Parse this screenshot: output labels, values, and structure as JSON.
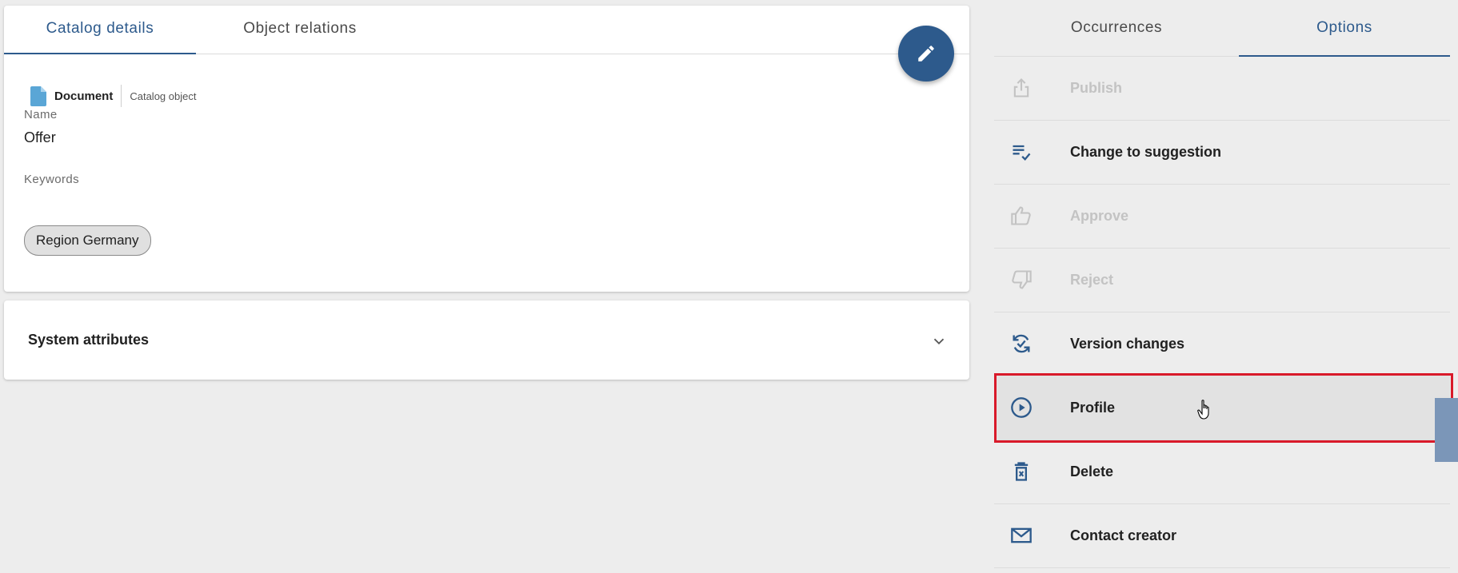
{
  "left_tabs": [
    {
      "label": "Catalog details",
      "active": true
    },
    {
      "label": "Object relations",
      "active": false
    }
  ],
  "edit_button": {
    "icon": "pencil-icon"
  },
  "object_type": {
    "type_label": "Document",
    "kind_label": "Catalog object",
    "icon": "document-icon"
  },
  "fields": {
    "name_label": "Name",
    "name_value": "Offer",
    "keywords_label": "Keywords",
    "keywords": [
      "Region Germany"
    ]
  },
  "system_attributes": {
    "title": "System attributes",
    "icon": "chevron-down-icon"
  },
  "right_tabs": [
    {
      "label": "Occurrences",
      "active": false
    },
    {
      "label": "Options",
      "active": true
    }
  ],
  "options": [
    {
      "label": "Publish",
      "icon": "share-icon",
      "disabled": true
    },
    {
      "label": "Change to suggestion",
      "icon": "playlist-check-icon",
      "disabled": false
    },
    {
      "label": "Approve",
      "icon": "thumb-up-icon",
      "disabled": true
    },
    {
      "label": "Reject",
      "icon": "thumb-down-icon",
      "disabled": true
    },
    {
      "label": "Version changes",
      "icon": "sync-check-icon",
      "disabled": false
    },
    {
      "label": "Profile",
      "icon": "play-circle-icon",
      "disabled": false,
      "hovered": true
    },
    {
      "label": "Delete",
      "icon": "delete-icon",
      "disabled": false
    },
    {
      "label": "Contact creator",
      "icon": "mail-icon",
      "disabled": false
    }
  ],
  "colors": {
    "accent": "#2d5a8c",
    "disabled": "#c3c3c3",
    "highlight": "#d91a2a",
    "doc_icon": "#5aa6d6"
  }
}
